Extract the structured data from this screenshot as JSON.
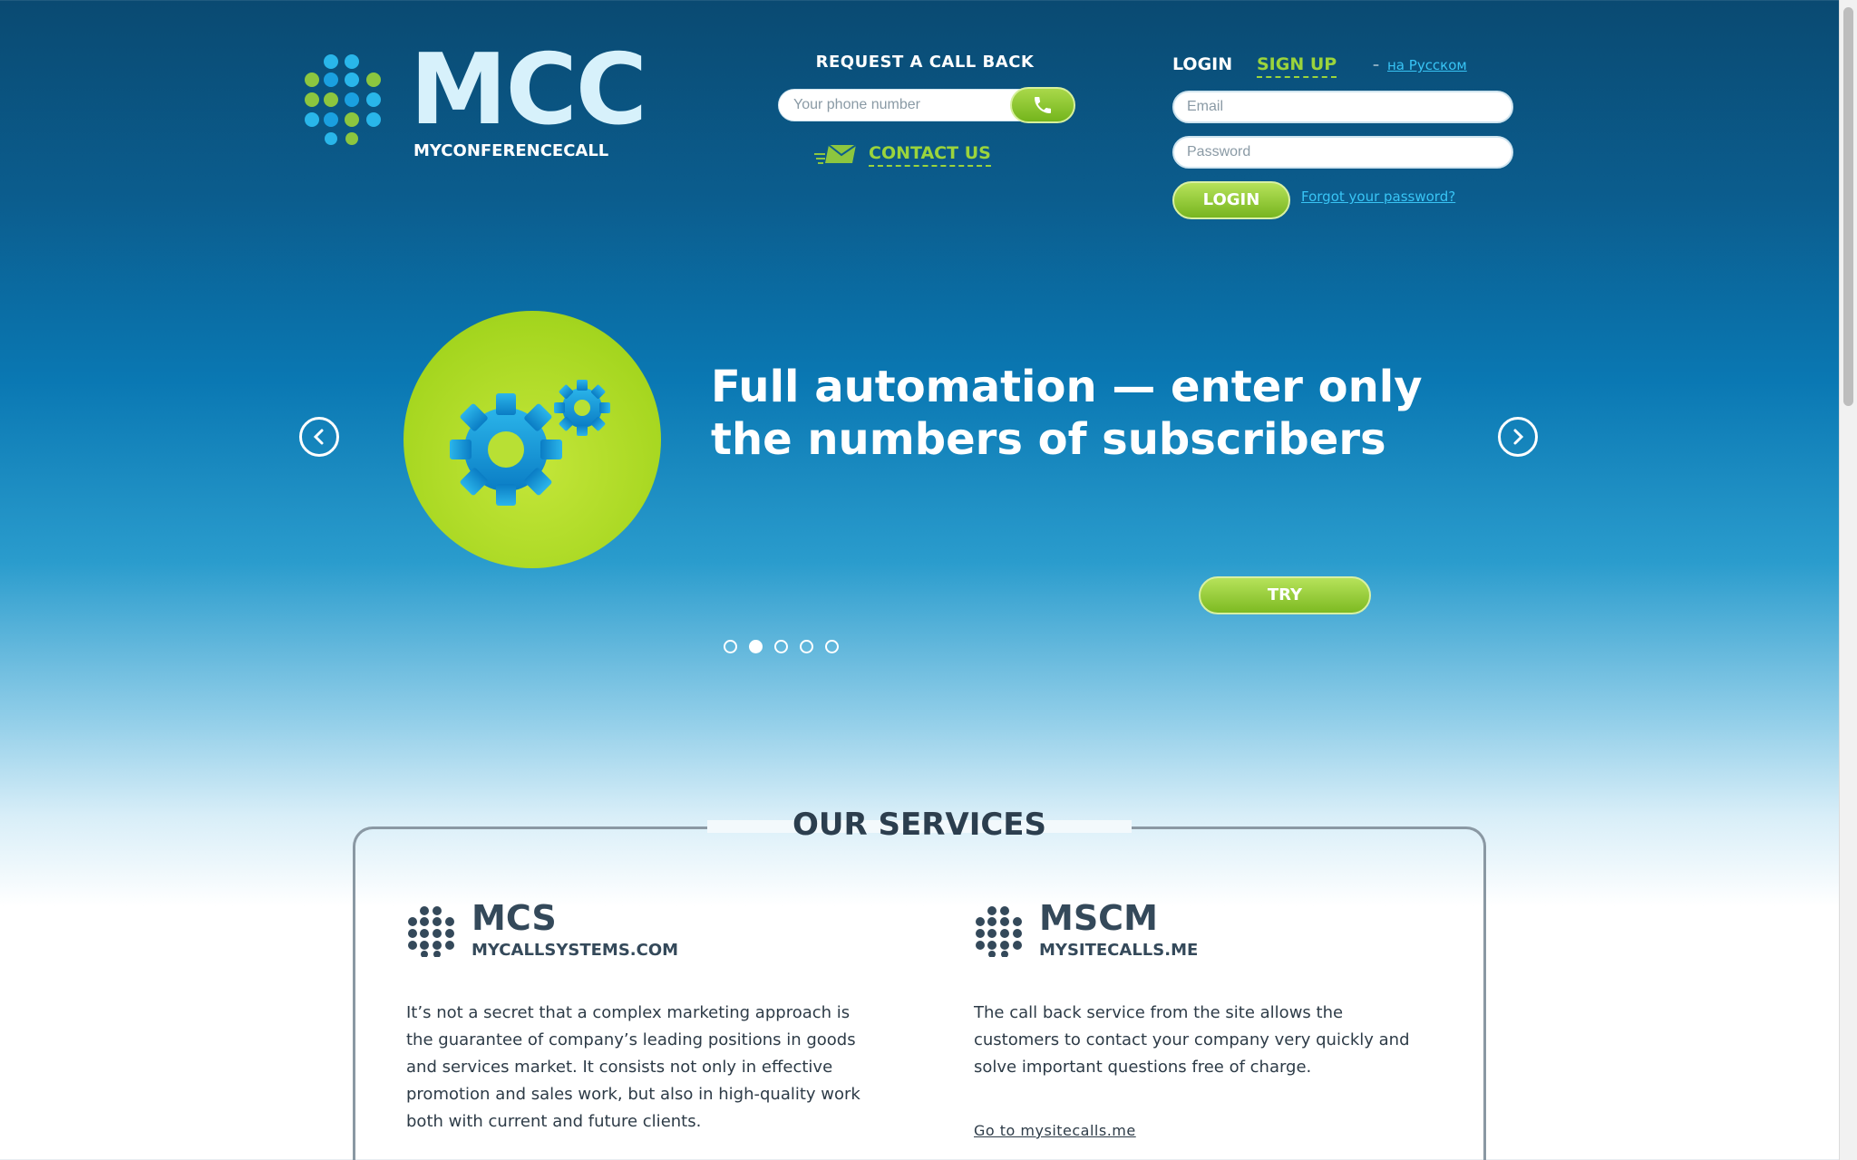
{
  "header": {
    "logo_text": "MCC",
    "logo_sub": "MYCONFERENCECALL",
    "callback": {
      "title": "REQUEST A CALL BACK",
      "phone_placeholder": "Your phone number",
      "contact_label": "CONTACT US"
    },
    "login": {
      "login_tab": "LOGIN",
      "signup_tab": "SIGN UP",
      "lang_dash": "–",
      "lang_link": "на Русском",
      "email_placeholder": "Email",
      "password_placeholder": "Password",
      "login_button": "LOGIN",
      "forgot_link": "Forgot your password?"
    }
  },
  "slider": {
    "title": "Full automation — enter only the numbers of subscribers",
    "try_button": "TRY",
    "active_index": 1,
    "dot_count": 5
  },
  "services": {
    "title": "OUR SERVICES",
    "items": [
      {
        "name": "MCS",
        "domain": "MYCALLSYSTEMS.COM",
        "text": "It’s not a secret that a complex marketing approach is the guarantee of company’s leading positions in goods and services market. It consists not only in effective promotion and sales work, but also in high-quality work both with current and future clients."
      },
      {
        "name": "MSCM",
        "domain": "MYSITECALLS.ME",
        "text": "The call back service from the site allows the customers to contact your company very quickly and solve important questions free of charge.",
        "link": "Go to mysitecalls.me"
      }
    ]
  },
  "colors": {
    "accent_green": "#9bd43c",
    "link_blue": "#38c4f5",
    "dark_text": "#2c3e4e"
  }
}
